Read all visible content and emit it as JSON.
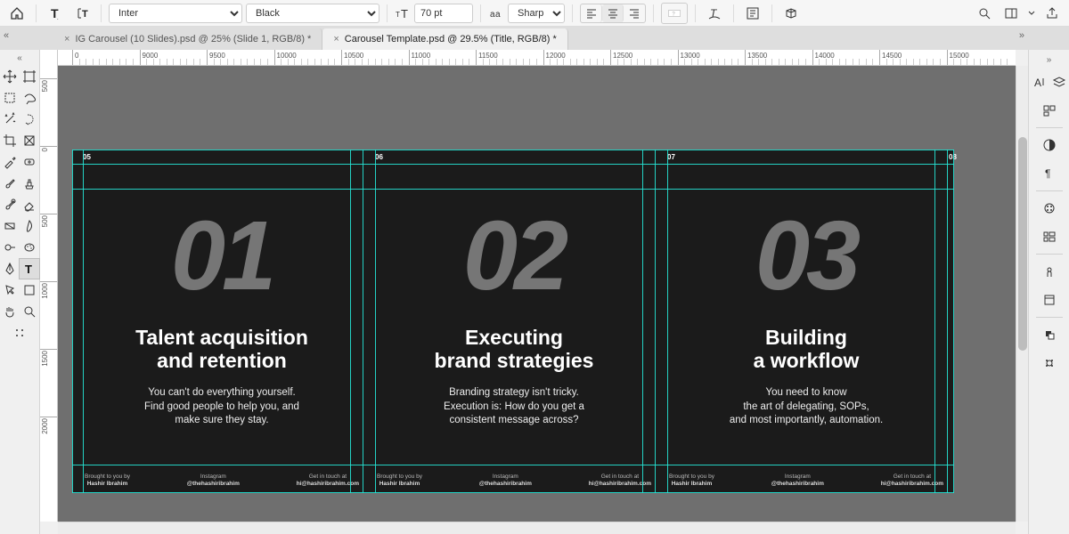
{
  "toolbar": {
    "font_family": "Inter",
    "font_weight": "Black",
    "font_size": "70 pt",
    "aa_mode": "Sharp"
  },
  "tabs": [
    {
      "label": "IG Carousel (10 Slides).psd @ 25% (Slide 1, RGB/8) *",
      "active": false
    },
    {
      "label": "Carousel Template.psd @ 29.5% (Title, RGB/8) *",
      "active": true
    }
  ],
  "ruler": {
    "h_labels": [
      "0",
      "9000",
      "9500",
      "10000",
      "10500",
      "11000",
      "11500",
      "12000",
      "12500",
      "13000",
      "13500",
      "14000",
      "14500",
      "15000"
    ],
    "v_labels": [
      "500",
      "0",
      "500",
      "1000",
      "1500",
      "2000"
    ]
  },
  "slides": [
    {
      "page_label": "05",
      "number": "01",
      "title": "Talent acquisition\nand retention",
      "desc": "You can't do everything yourself.\nFind good people to help you, and\nmake sure they stay."
    },
    {
      "page_label": "06",
      "number": "02",
      "title": "Executing\nbrand strategies",
      "desc": "Branding strategy isn't tricky.\nExecution is: How do you get a\nconsistent message across?"
    },
    {
      "page_label": "07",
      "number": "03",
      "title": "Building\na workflow",
      "desc": "You need to know\nthe art of delegating, SOPs,\nand most importantly, automation."
    }
  ],
  "next_page_label": "08",
  "footer": {
    "left_label": "Brought to you by",
    "left_value": "Hashir Ibrahim",
    "mid_label": "Instagram",
    "mid_value": "@thehashiribrahim",
    "right_label": "Get in touch at",
    "right_value": "hi@hashiribrahim.com"
  }
}
